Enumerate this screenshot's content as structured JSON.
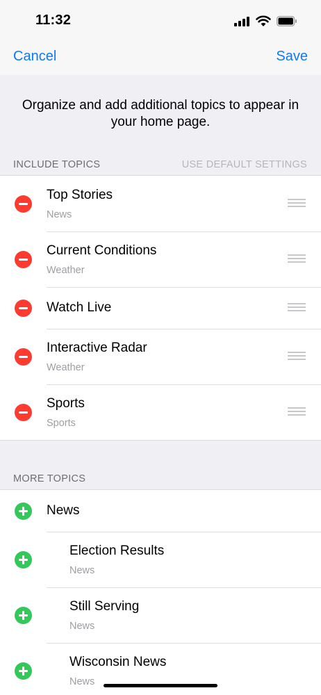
{
  "status_bar": {
    "time": "11:32",
    "icons": [
      "cellular-signal-icon",
      "wifi-icon",
      "battery-icon"
    ]
  },
  "nav": {
    "cancel_label": "Cancel",
    "save_label": "Save"
  },
  "intro_text": "Organize and add additional topics to appear in your home page.",
  "include_section": {
    "header": "INCLUDE TOPICS",
    "action": "USE DEFAULT SETTINGS",
    "items": [
      {
        "title": "Top Stories",
        "subtitle": "News"
      },
      {
        "title": "Current Conditions",
        "subtitle": "Weather"
      },
      {
        "title": "Watch Live",
        "subtitle": ""
      },
      {
        "title": "Interactive Radar",
        "subtitle": "Weather"
      },
      {
        "title": "Sports",
        "subtitle": "Sports"
      }
    ]
  },
  "more_section": {
    "header": "MORE TOPICS",
    "items": [
      {
        "title": "News",
        "subtitle": ""
      },
      {
        "title": "Election Results",
        "subtitle": "News"
      },
      {
        "title": "Still Serving",
        "subtitle": "News"
      },
      {
        "title": "Wisconsin News",
        "subtitle": "News"
      }
    ]
  },
  "colors": {
    "accent": "#0a7aff",
    "remove": "#ff3b30",
    "add": "#34c759",
    "background": "#efeff4"
  }
}
